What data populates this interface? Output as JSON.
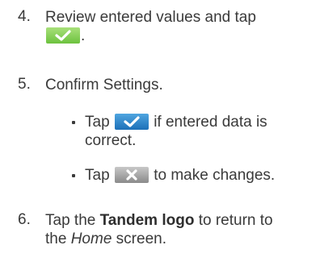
{
  "steps": {
    "s4": {
      "number": "4.",
      "line1": "Review entered values and tap",
      "after_button": "."
    },
    "s5": {
      "number": "5.",
      "text": "Confirm Settings.",
      "bullets": [
        {
          "pre": "Tap",
          "post_line1": "if entered data is",
          "line2": "correct."
        },
        {
          "pre": "Tap",
          "post_line1": "to make changes."
        }
      ]
    },
    "s6": {
      "number": "6.",
      "pre": "Tap the",
      "bold": "Tandem logo",
      "post": "to return to",
      "line2_pre": "the",
      "line2_italic": "Home",
      "line2_post": "screen."
    }
  },
  "icons": {
    "confirm_green": "checkmark-icon",
    "confirm_blue": "checkmark-icon",
    "cancel_gray": "x-icon"
  },
  "colors": {
    "text": "#3a3a3a",
    "green_button": "#7ccb4a",
    "blue_button": "#2a82c9",
    "gray_button": "#a0a0a0"
  }
}
